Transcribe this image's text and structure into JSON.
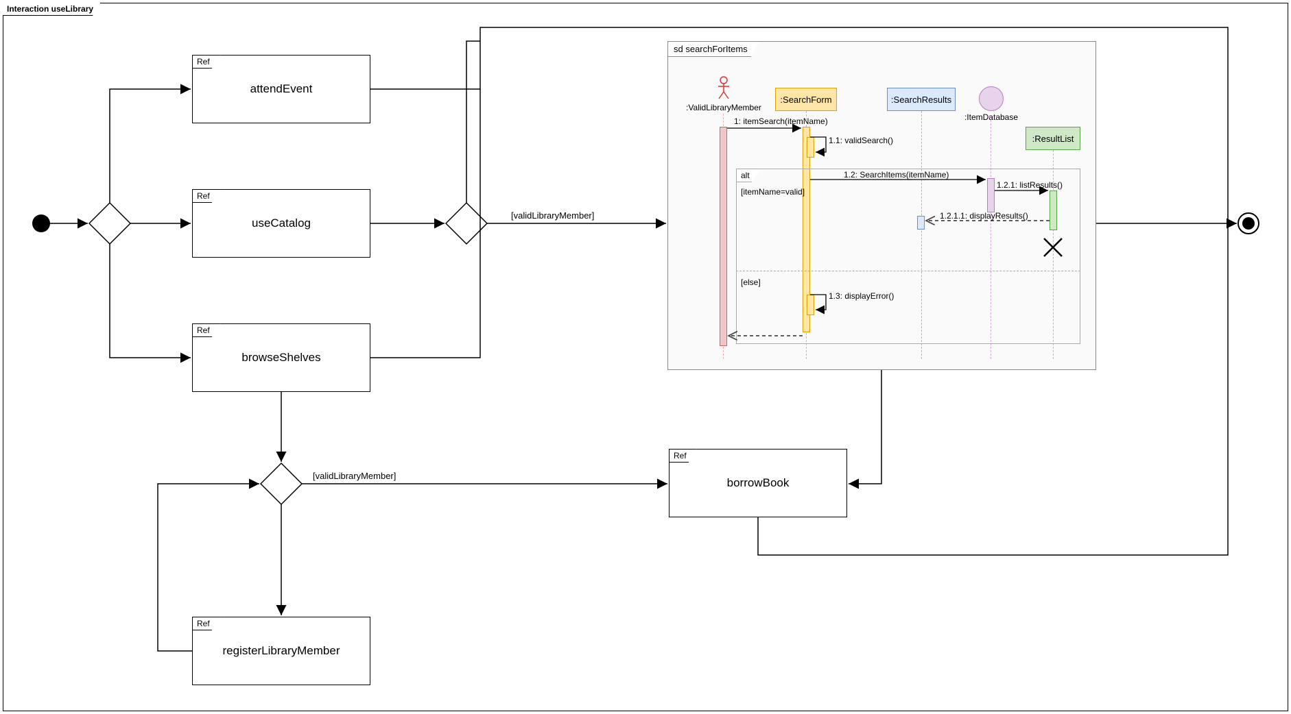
{
  "frame": {
    "title": "Interaction useLibrary"
  },
  "refs": {
    "attendEvent": {
      "tab": "Ref",
      "label": "attendEvent"
    },
    "useCatalog": {
      "tab": "Ref",
      "label": "useCatalog"
    },
    "browseShelves": {
      "tab": "Ref",
      "label": "browseShelves"
    },
    "borrowBook": {
      "tab": "Ref",
      "label": "borrowBook"
    },
    "registerLibraryMember": {
      "tab": "Ref",
      "label": "registerLibraryMember"
    }
  },
  "guards": {
    "validLibraryMember1": "[validLibraryMember]",
    "validLibraryMember2": "[validLibraryMember]"
  },
  "sd": {
    "title": "sd searchForItems",
    "lifelines": {
      "validMember": {
        "label": ":ValidLibraryMember"
      },
      "searchForm": {
        "label": ":SearchForm"
      },
      "searchResults": {
        "label": ":SearchResults"
      },
      "itemDatabase": {
        "label": ":ItemDatabase"
      },
      "resultList": {
        "label": ":ResultList"
      }
    },
    "messages": {
      "m1": "1: itemSearch(itemName)",
      "m11": "1.1: validSearch()",
      "m12": "1.2: SearchItems(itemName)",
      "m121": "1.2.1: listResults()",
      "m1211": "1.2.1.1: displayResults()",
      "m13": "1.3: displayError()"
    },
    "alt": {
      "label": "alt",
      "guard1": "[itemName=valid]",
      "guard2": "[else]"
    }
  }
}
